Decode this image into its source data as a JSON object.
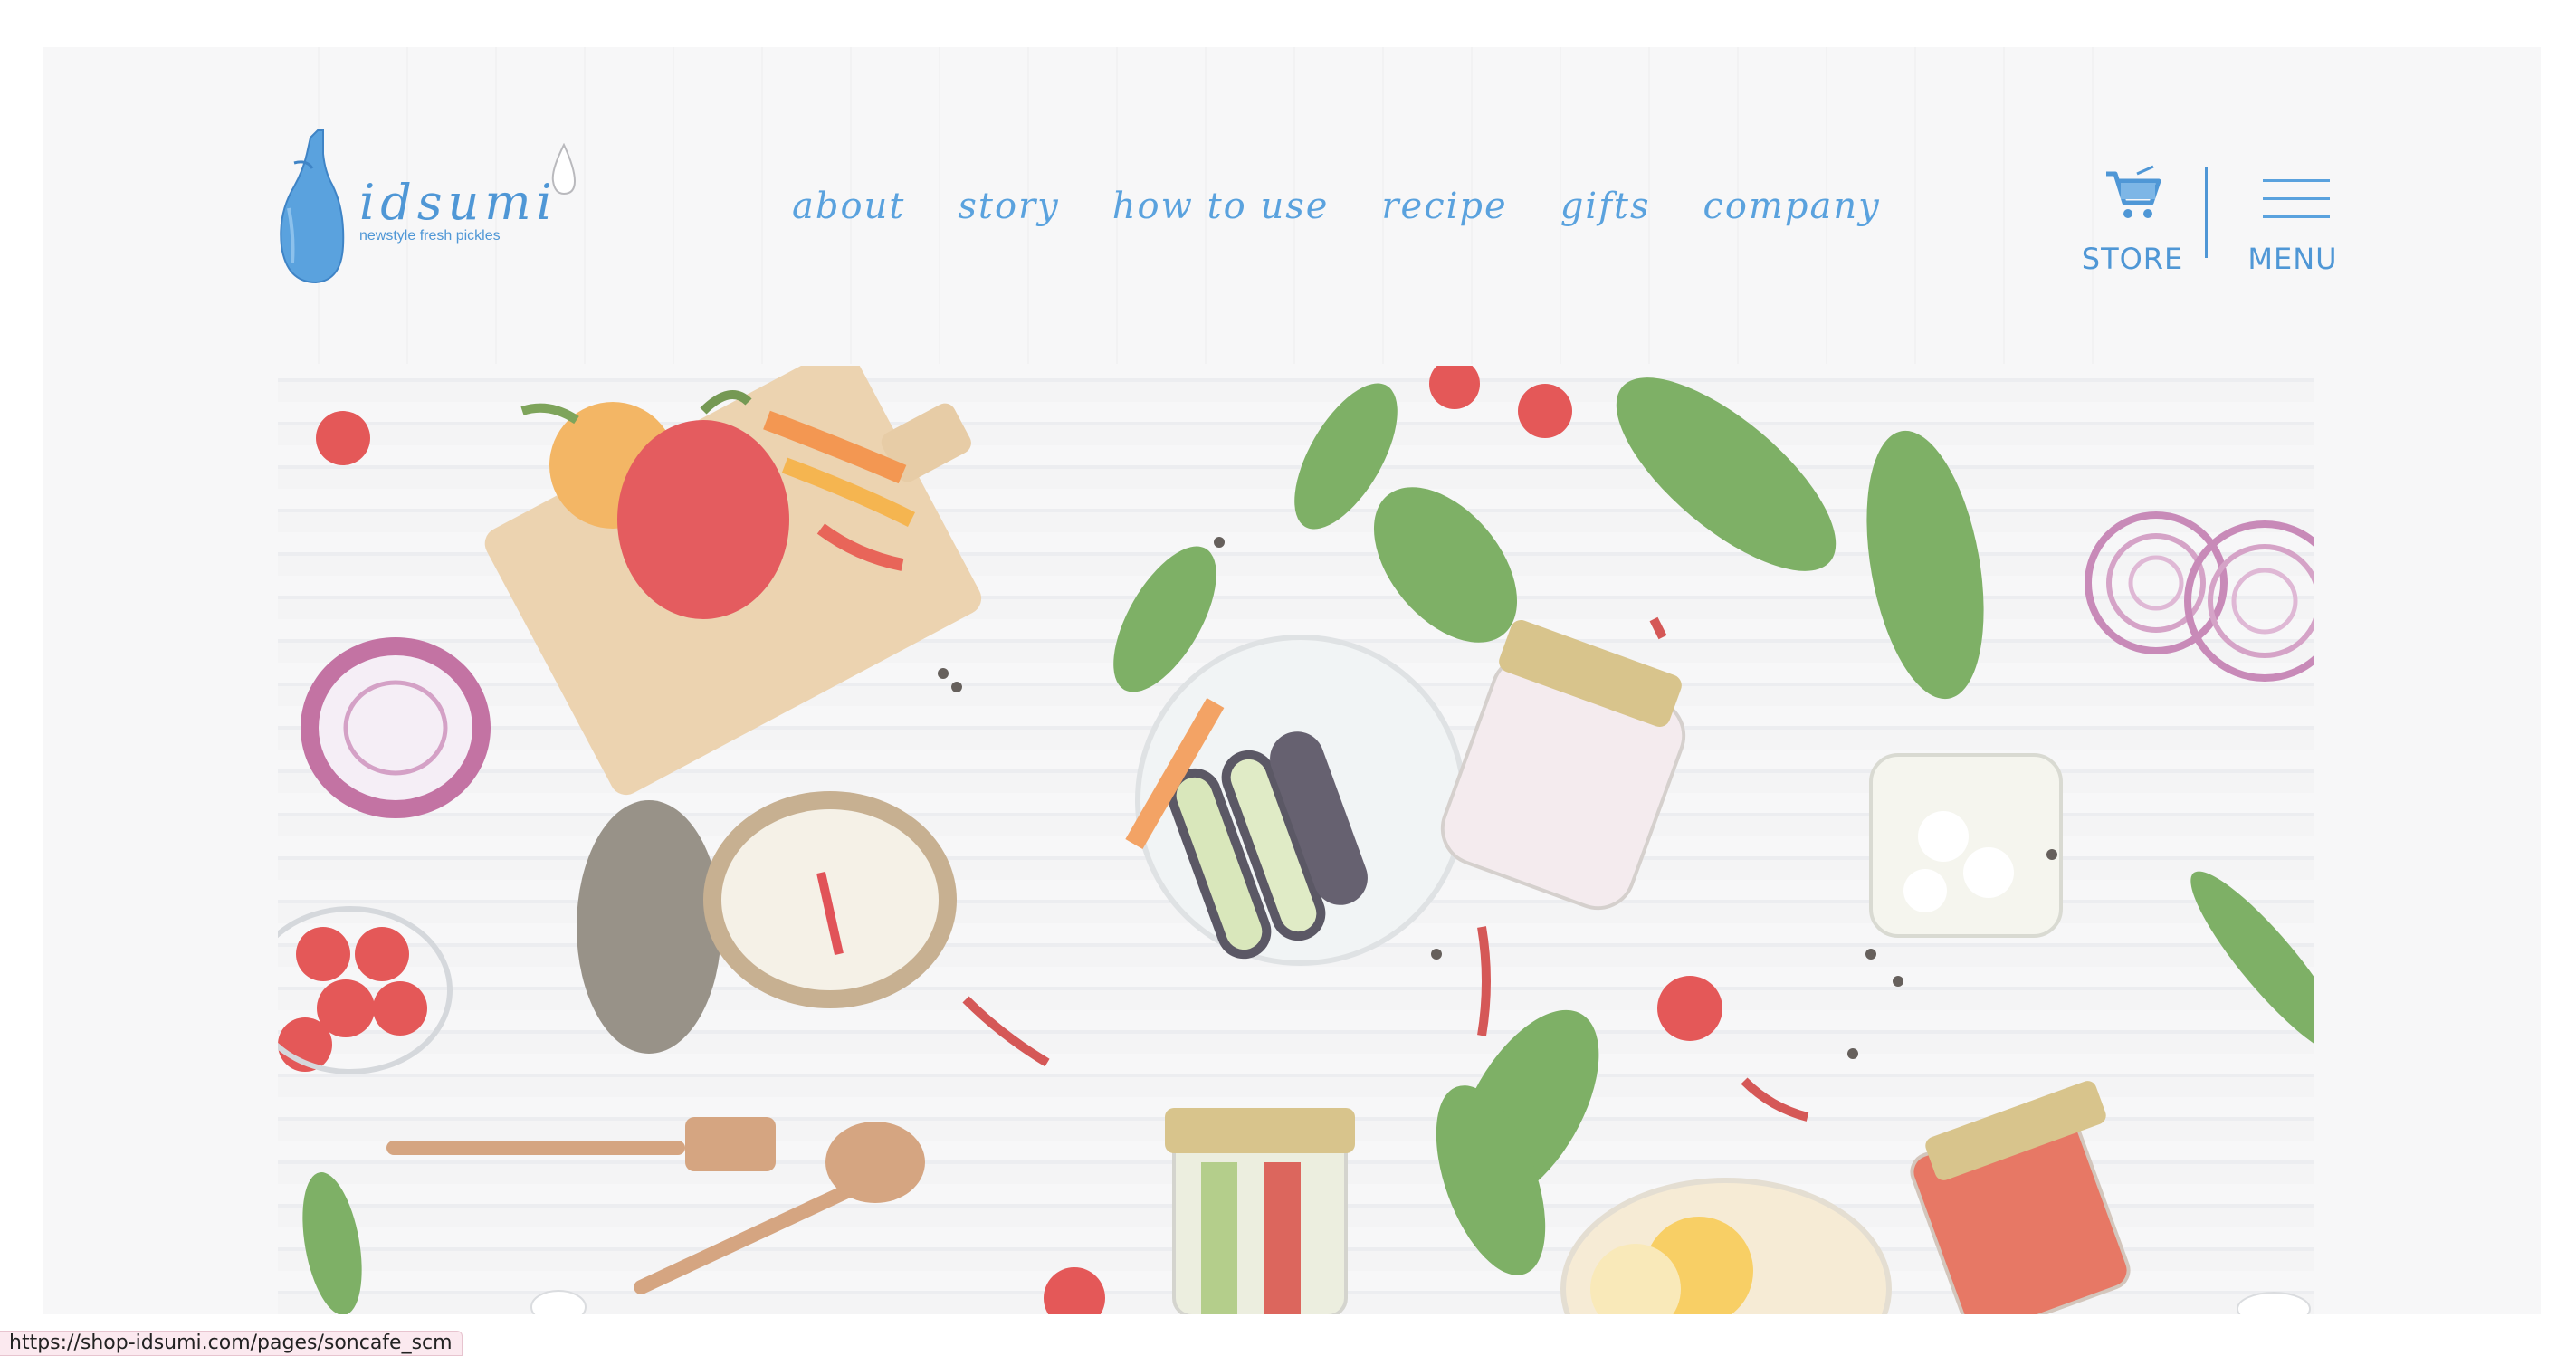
{
  "brand": {
    "name": "idsumi",
    "tagline": "newstyle fresh pickles",
    "accent_color": "#4f97d6"
  },
  "nav": {
    "items": [
      {
        "label": "about"
      },
      {
        "label": "story"
      },
      {
        "label": "how to use"
      },
      {
        "label": "recipe"
      },
      {
        "label": "gifts"
      },
      {
        "label": "company"
      }
    ]
  },
  "header_actions": {
    "store_label": "STORE",
    "store_icon": "shopping-cart-icon",
    "menu_label": "MENU",
    "menu_icon": "hamburger-icon"
  },
  "hero": {
    "image_alt": "Flat lay of fresh vegetables and jars of pickles on a striped tablecloth"
  },
  "status_bar": {
    "url": "https://shop-idsumi.com/pages/soncafe_scm"
  }
}
